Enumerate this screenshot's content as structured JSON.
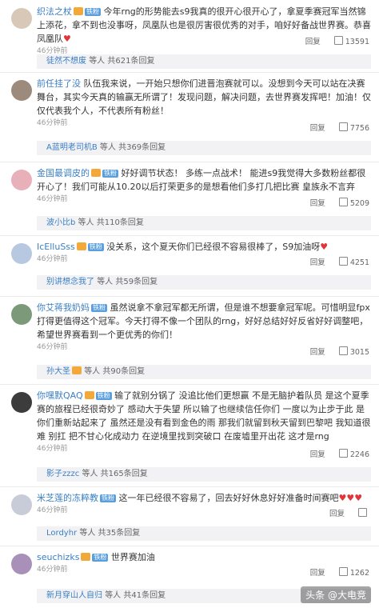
{
  "labels": {
    "reply": "回复",
    "more_replies_prefix": "等人 共",
    "more_replies_suffix": "条回复"
  },
  "comments": [
    {
      "user": "织法之杖",
      "badge": "铁粉",
      "vip": true,
      "text": "今年rng的形势能去s9我真的很开心很开心了，拿夏季赛冠军当然锦上添花，拿不到也没事呀，凤凰队也是很厉害很优秀的对手，咱好好备战世界赛。恭喜凤凰队",
      "time": "46分钟前",
      "likes": "13591",
      "reply_user": "徒然不想废",
      "reply_count": "621"
    },
    {
      "user": "前任挂了没",
      "badge": "",
      "vip": false,
      "text": "队伍我来说，一开始只想你们进晋泡赛就可以。没想到今天可以站在决赛舞台，其实今天真的输赢无所谓了！发现问题，解决问题，去世界赛发挥吧！加油！仅仅代表我个人，不代表所有粉丝！",
      "time": "46分钟前",
      "likes": "7756",
      "reply_user": "A蓝明老司机B",
      "reply_count": "369"
    },
    {
      "user": "金国最调皮的",
      "badge": "铁粉",
      "vip": true,
      "text": "好好调节状态！ 多练一点战术！ 能进s9我觉得大多数粉丝都很开心了！我们可能从10.20以后打荣更多的是想看他们多打几把比赛 皇族永不言弃",
      "time": "46分钟前",
      "likes": "5209",
      "reply_user": "波小比b",
      "reply_count": "110"
    },
    {
      "user": "IcElluSss",
      "badge": "铁粉",
      "vip": true,
      "text": "没关系，这个夏天你们已经很不容易很棒了，S9加油呀",
      "time": "46分钟前",
      "likes": "4251",
      "reply_user": "别讲想念我了",
      "reply_count": "59"
    },
    {
      "user": "你艾蒋我奶妈",
      "badge": "铁粉",
      "vip": false,
      "text": "虽然说拿不拿冠军都无所谓，但是谁不想要拿冠军呢。可惜明显fpx打得更值得这个冠军。今天打得不像一个团队的rng，好好总结好好反省好好调整吧，希望世界赛看到一个更优秀的你们！",
      "time": "46分钟前",
      "likes": "3015",
      "reply_user": "孙大圣",
      "reply_count": "90"
    },
    {
      "user": "你嘿默QAQ",
      "badge": "铁粉",
      "vip": true,
      "text": "输了就别分锅了 没追比他们更想赢 不是无脑护着队员 是这个夏季赛的旅程已经很奇妙了 感动大于失望 所以输了也继续信任你们 一度以为止步于此 是你们重新站起来了 虽然还是没有看到金色的雨 那我们就留到秋天留到巴黎吧 我知道很难 别扛 把不甘心化成动力 在逆境里找到突破口 在废墟里开出花 这才是rng",
      "time": "46分钟前",
      "likes": "2246",
      "reply_user": "影子zzzc",
      "reply_count": "165"
    },
    {
      "user": "米芝莲的冻粹教",
      "badge": "铁粉",
      "vip": false,
      "text": "这一年已经很不容易了，回去好好休息好好准备时间赛吧",
      "time": "46分钟前",
      "likes": "",
      "reply_user": "Lordyhr",
      "reply_count": "35"
    },
    {
      "user": "seuchizks",
      "badge": "铁粉",
      "vip": true,
      "text": "世界赛加油",
      "time": "46分钟前",
      "likes": "1262",
      "reply_user": "新月穿山人自归",
      "reply_count": "41"
    }
  ],
  "watermark": "头条 @大电竞",
  "colors": {
    "link": "#3a7fc4",
    "badge": "#5a9fdc",
    "vip": "#f3a93a",
    "reply_bg": "#f2f2f5"
  }
}
